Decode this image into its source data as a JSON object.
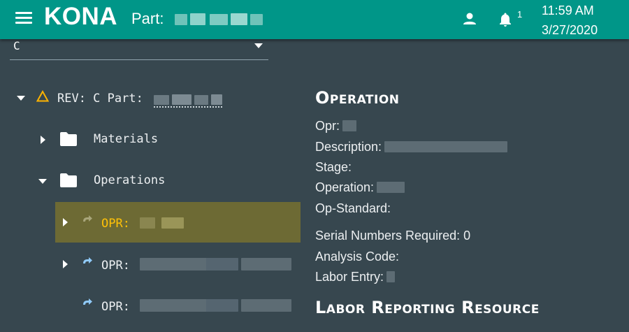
{
  "topbar": {
    "app_title": "KONA",
    "part_label": "Part:",
    "notification_count": "1",
    "time": "11:59 AM",
    "date": "3/27/2020",
    "menu_icon": "hamburger-menu-icon",
    "user_icon": "person-icon",
    "bell_icon": "bell-icon",
    "colors": {
      "bar": "#009688",
      "text": "#ffffff"
    }
  },
  "revision_select": {
    "value": "C"
  },
  "tree": {
    "root": {
      "text": "REV: C Part:",
      "icon": "revision-triangle-icon"
    },
    "materials": {
      "label": "Materials",
      "icon": "folder-icon"
    },
    "operations": {
      "label": "Operations",
      "icon": "folder-icon"
    },
    "opr_prefix": "OPR:",
    "opr_icon": "redo-arrow-icon",
    "selected_color": "#6d6a34",
    "selected_text_color": "#ffc107"
  },
  "operation": {
    "heading": "Operation",
    "fields": {
      "opr": "Opr:",
      "description": "Description:",
      "stage": "Stage:",
      "operation": "Operation:",
      "op_standard": "Op-Standard:",
      "serial_label": "Serial Numbers Required:",
      "serial_value": "0",
      "analysis_code": "Analysis Code:",
      "labor_entry": "Labor Entry:"
    }
  },
  "labor_reporting": {
    "heading": "Labor Reporting Resource"
  },
  "background": "#37474f"
}
